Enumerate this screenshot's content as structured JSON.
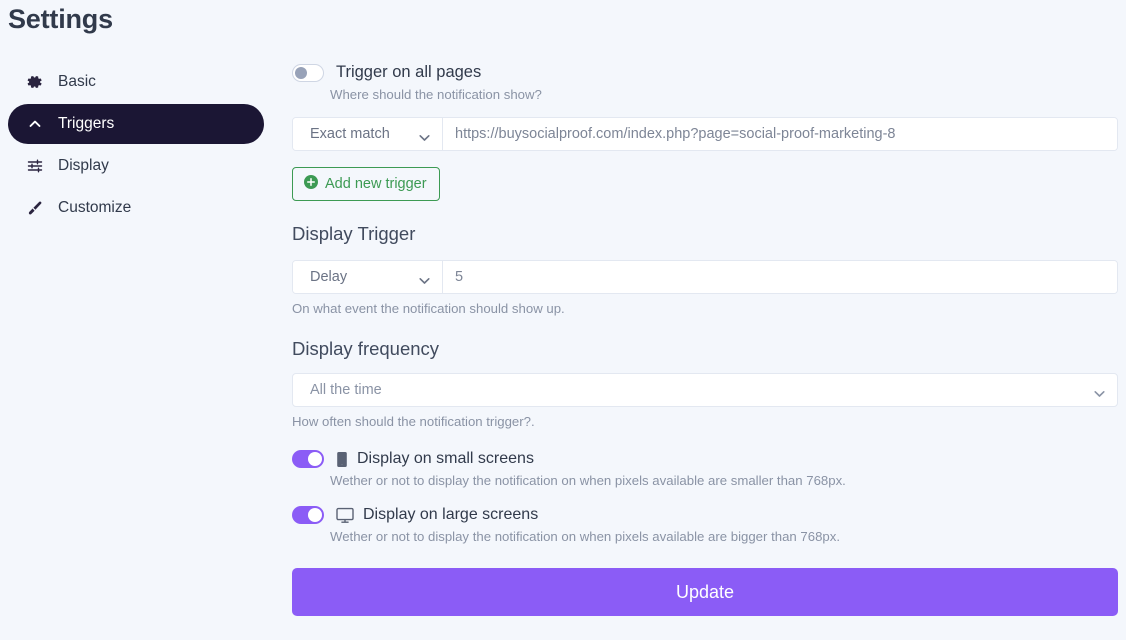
{
  "header": {
    "title": "Settings"
  },
  "sidebar": {
    "items": [
      {
        "label": "Basic",
        "icon": "gear-icon",
        "active": false
      },
      {
        "label": "Triggers",
        "icon": "chevron-up-icon",
        "active": true
      },
      {
        "label": "Display",
        "icon": "sliders-icon",
        "active": false
      },
      {
        "label": "Customize",
        "icon": "brush-icon",
        "active": false
      }
    ]
  },
  "main": {
    "trigger_all_pages": {
      "label": "Trigger on all pages",
      "help": "Where should the notification show?",
      "enabled": false
    },
    "trigger_rule": {
      "match_type": "Exact match",
      "url": "https://buysocialproof.com/index.php?page=social-proof-marketing-8"
    },
    "add_trigger_button": {
      "label": "Add new trigger",
      "icon": "plus-circle-icon"
    },
    "display_trigger": {
      "title": "Display Trigger",
      "event": "Delay",
      "value": "5",
      "help": "On what event the notification should show up."
    },
    "display_frequency": {
      "title": "Display frequency",
      "value": "All the time",
      "help": "How often should the notification trigger?."
    },
    "small_screens": {
      "label": "Display on small screens",
      "icon": "mobile-icon",
      "enabled": true,
      "help": "Wether or not to display the notification on when pixels available are smaller than 768px."
    },
    "large_screens": {
      "label": "Display on large screens",
      "icon": "monitor-icon",
      "enabled": true,
      "help": "Wether or not to display the notification on when pixels available are bigger than 768px."
    },
    "update_button": {
      "label": "Update"
    }
  },
  "colors": {
    "background": "#f4f7fc",
    "sidebar_active": "#1b1634",
    "accent_purple": "#8b5cf6",
    "accent_green": "#3c9a53",
    "text": "#313a4b",
    "muted": "#8a93a5"
  }
}
